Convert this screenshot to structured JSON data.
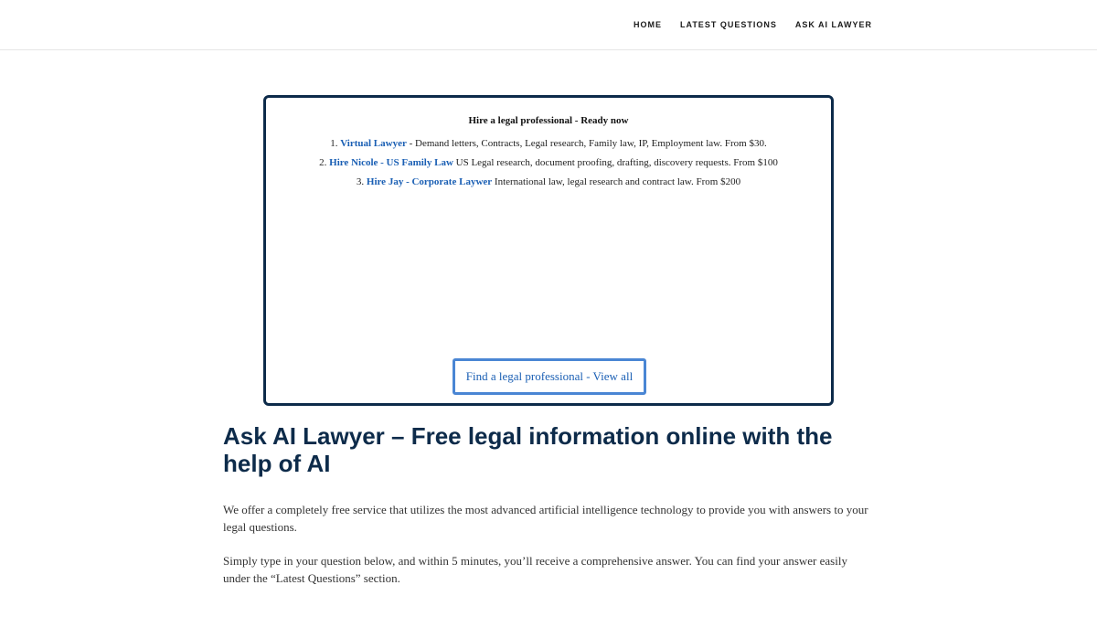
{
  "nav": {
    "items": [
      {
        "label": "HOME"
      },
      {
        "label": "LATEST QUESTIONS"
      },
      {
        "label": "ASK AI LAWYER"
      }
    ]
  },
  "promo": {
    "title": "Hire a legal professional - Ready now",
    "items": [
      {
        "num": "1.",
        "link": "Virtual Lawyer",
        "text": " - Demand letters, Contracts, Legal research, Family law, IP, Employment law. From $30."
      },
      {
        "num": "2.",
        "link": "Hire Nicole - US Family Law",
        "text": " US Legal research, document proofing, drafting, discovery requests. From $100"
      },
      {
        "num": "3.",
        "link": "Hire Jay - Corporate Laywer",
        "text": " International law, legal research and contract law. From $200"
      }
    ],
    "button_label": "Find a legal professional - View all"
  },
  "main": {
    "heading": "Ask AI Lawyer – Free legal information online with the help of AI",
    "paragraph1": "We offer a completely free service that utilizes the most advanced artificial intelligence technology to provide you with answers to your legal questions.",
    "paragraph2": "Simply type in your question below, and within 5 minutes, you’ll receive a comprehensive answer. You can find your answer easily under the “Latest Questions” section."
  },
  "colors": {
    "accent": "#0d2b4a",
    "link": "#1a5fb4",
    "button_border": "#4a86d4"
  }
}
